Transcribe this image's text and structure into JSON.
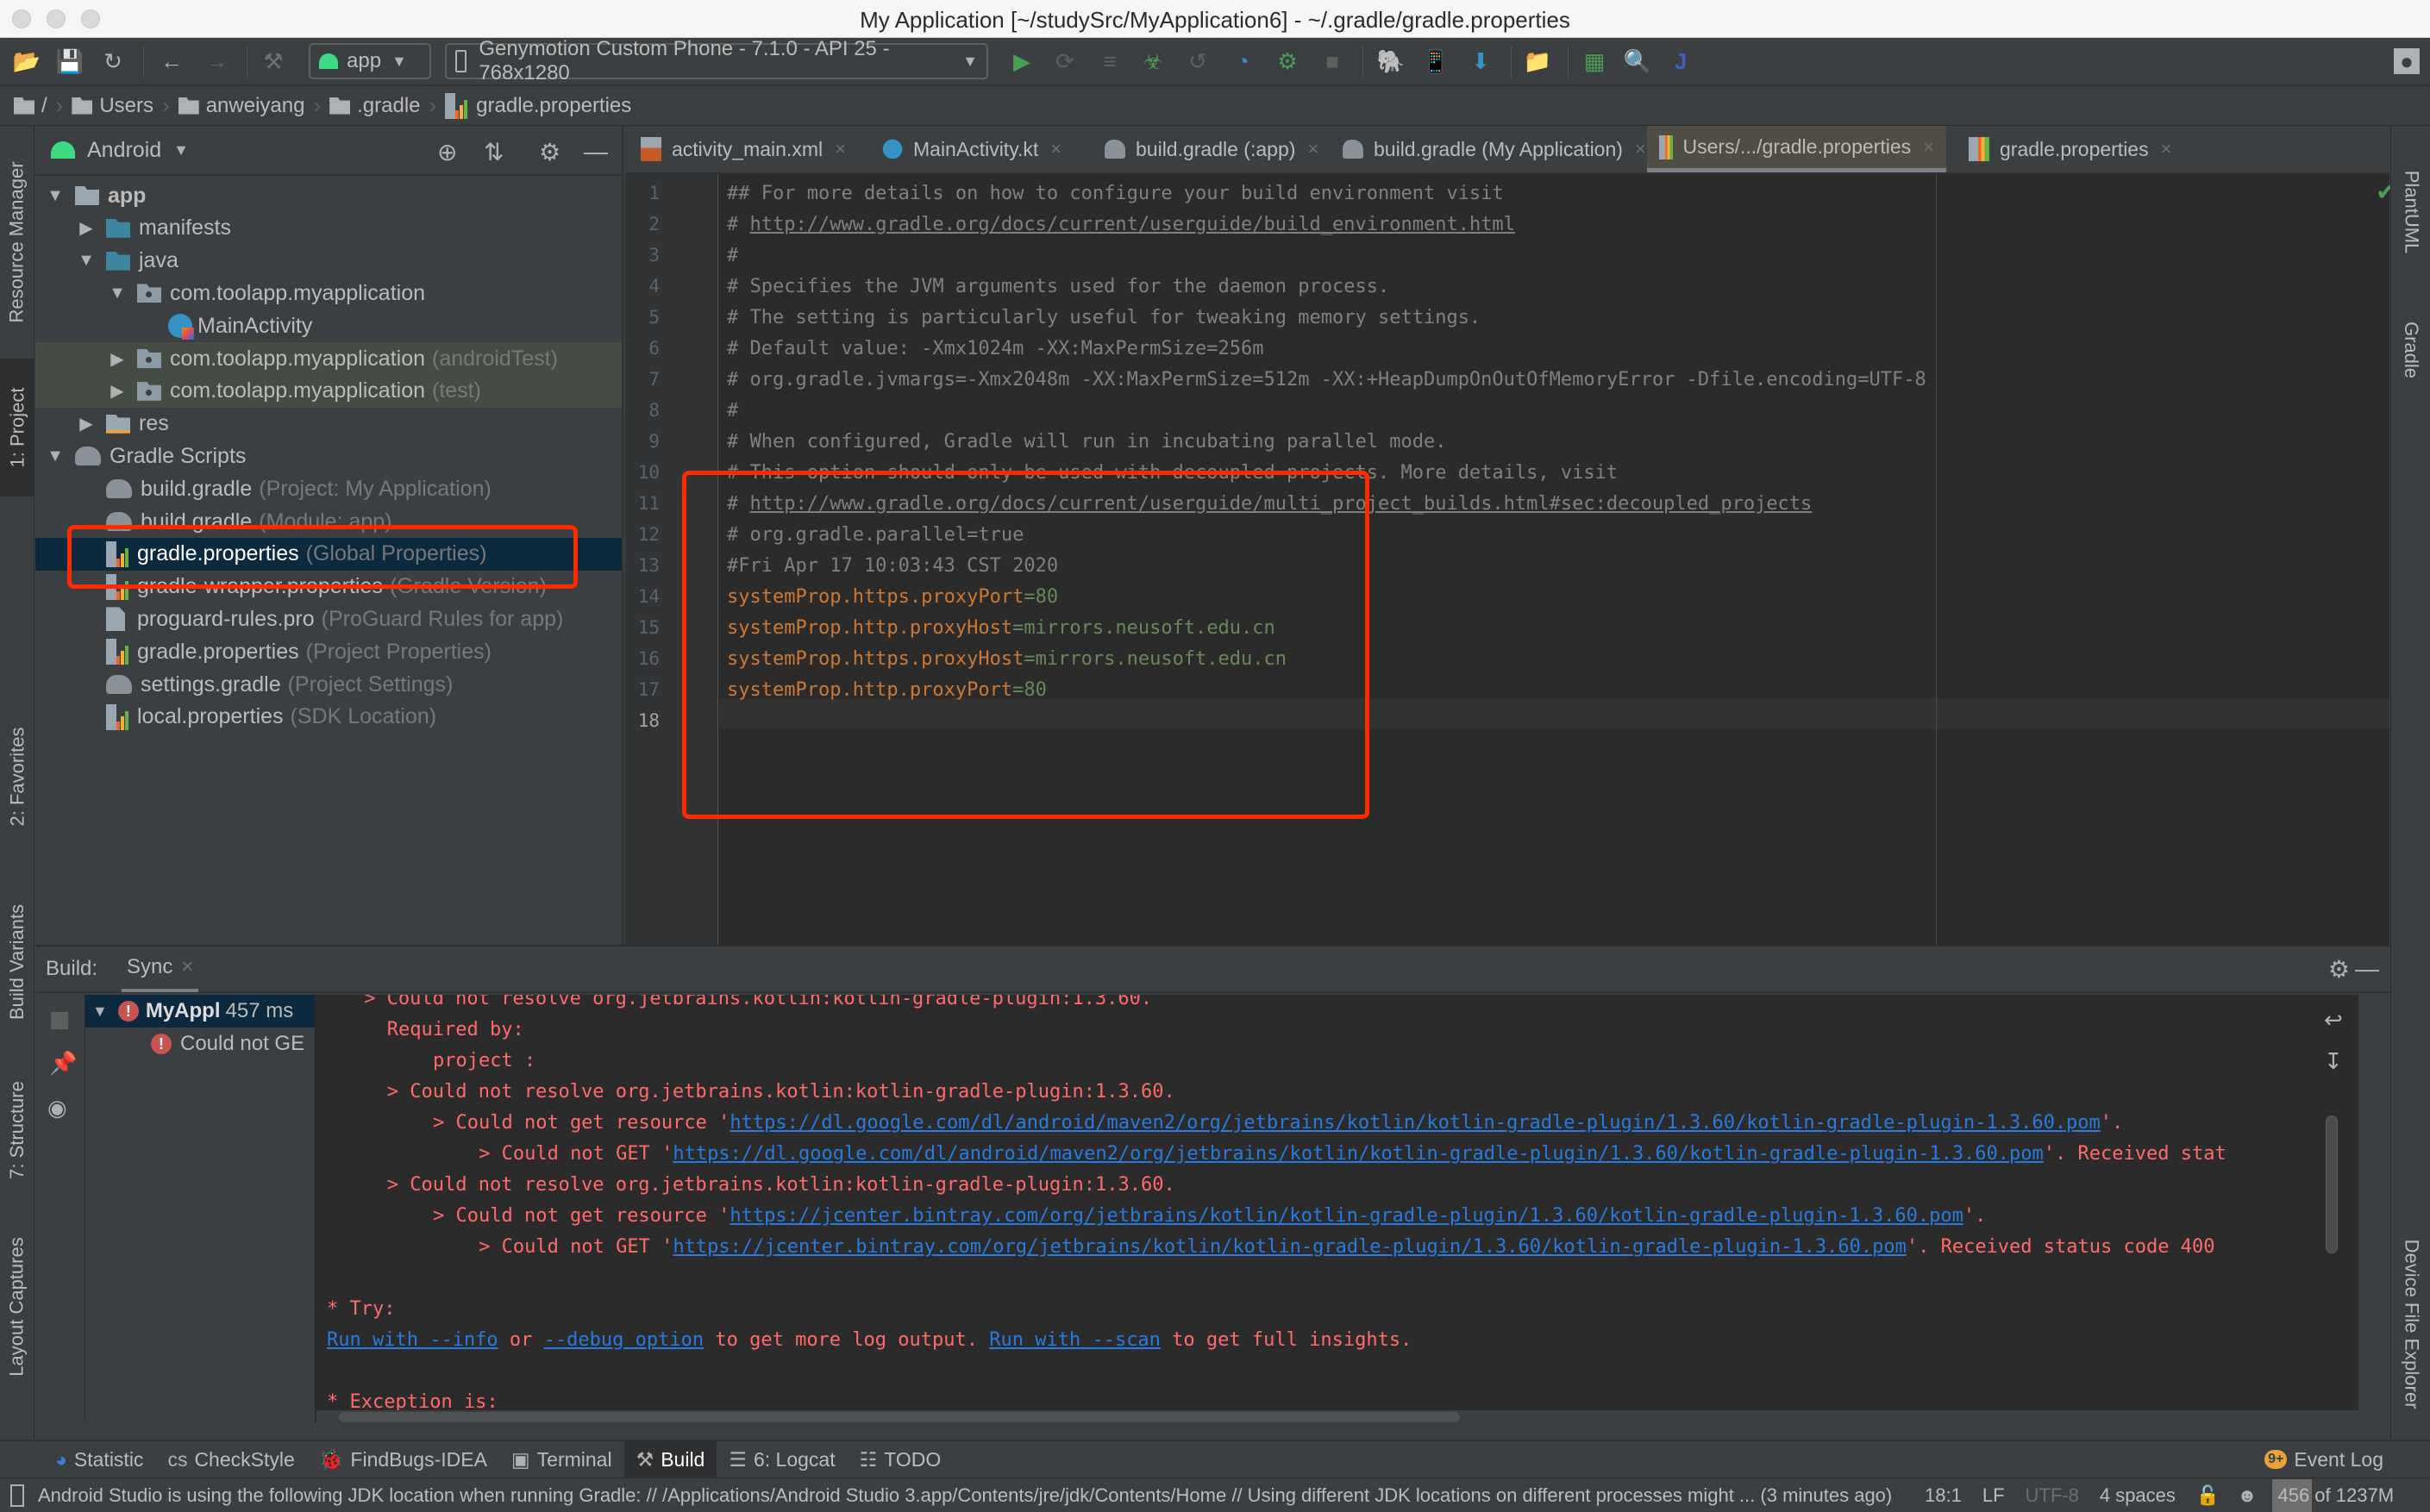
{
  "window": {
    "title": "My Application [~/studySrc/MyApplication6] - ~/.gradle/gradle.properties"
  },
  "toolbar": {
    "icons": [
      "open-folder-icon",
      "save-icon",
      "sync-icon",
      "back-icon",
      "forward-icon",
      "hammer-icon",
      "run-icon",
      "apply-changes-icon",
      "apply-code-changes-icon",
      "debug-icon",
      "attach-debugger-icon",
      "profile-icon",
      "coverage-icon",
      "stop-icon",
      "gradle-sync-icon",
      "avd-manager-icon",
      "sdk-manager-icon",
      "project-structure-icon",
      "terminal-icon",
      "search-icon",
      "jetbrains-icon",
      "user-icon"
    ],
    "config_combo": "app",
    "device_combo": "Genymotion Custom Phone - 7.1.0 - API 25 - 768x1280"
  },
  "breadcrumb": [
    "/",
    "Users",
    "anweiyang",
    ".gradle",
    "gradle.properties"
  ],
  "left_strip": {
    "tabs": [
      "Resource Manager",
      "1: Project",
      "2: Favorites",
      "Build Variants",
      "7: Structure",
      "Layout Captures"
    ]
  },
  "right_strip": {
    "tabs": [
      "PlantUML",
      "Gradle",
      "Device File Explorer"
    ]
  },
  "project_panel": {
    "view_mode": "Android",
    "tree": [
      {
        "label": "app",
        "hint": "",
        "expanded": true
      },
      {
        "label": "manifests",
        "hint": "",
        "expanded": false
      },
      {
        "label": "java",
        "hint": "",
        "expanded": true
      },
      {
        "label": "com.toolapp.myapplication",
        "hint": "",
        "expanded": true
      },
      {
        "label": "MainActivity",
        "hint": ""
      },
      {
        "label": "com.toolapp.myapplication",
        "hint": "(androidTest)",
        "expanded": false
      },
      {
        "label": "com.toolapp.myapplication",
        "hint": "(test)",
        "expanded": false
      },
      {
        "label": "res",
        "hint": "",
        "expanded": false
      },
      {
        "label": "Gradle Scripts",
        "hint": "",
        "expanded": true
      },
      {
        "label": "build.gradle",
        "hint": "(Project: My Application)"
      },
      {
        "label": "build.gradle",
        "hint": "(Module: app)"
      },
      {
        "label": "gradle.properties",
        "hint": "(Global Properties)",
        "selected": true
      },
      {
        "label": "gradle-wrapper.properties",
        "hint": "(Gradle Version)"
      },
      {
        "label": "proguard-rules.pro",
        "hint": "(ProGuard Rules for app)"
      },
      {
        "label": "gradle.properties",
        "hint": "(Project Properties)"
      },
      {
        "label": "settings.gradle",
        "hint": "(Project Settings)"
      },
      {
        "label": "local.properties",
        "hint": "(SDK Location)"
      }
    ]
  },
  "editor": {
    "tabs": [
      {
        "label": "activity_main.xml",
        "active": false
      },
      {
        "label": "MainActivity.kt",
        "active": false
      },
      {
        "label": "build.gradle (:app)",
        "active": false
      },
      {
        "label": "build.gradle (My Application)",
        "active": false
      },
      {
        "label": "Users/.../gradle.properties",
        "active": true
      },
      {
        "label": "gradle.properties",
        "active": false
      }
    ],
    "lines": [
      {
        "n": "1",
        "text": "## For more details on how to configure your build environment visit"
      },
      {
        "n": "2",
        "prefix": "# ",
        "url": "http://www.gradle.org/docs/current/userguide/build_environment.html"
      },
      {
        "n": "3",
        "text": "#"
      },
      {
        "n": "4",
        "text": "# Specifies the JVM arguments used for the daemon process."
      },
      {
        "n": "5",
        "text": "# The setting is particularly useful for tweaking memory settings."
      },
      {
        "n": "6",
        "text": "# Default value: -Xmx1024m -XX:MaxPermSize=256m"
      },
      {
        "n": "7",
        "text": "# org.gradle.jvmargs=-Xmx2048m -XX:MaxPermSize=512m -XX:+HeapDumpOnOutOfMemoryError -Dfile.encoding=UTF-8"
      },
      {
        "n": "8",
        "text": "#"
      },
      {
        "n": "9",
        "text": "# When configured, Gradle will run in incubating parallel mode."
      },
      {
        "n": "10",
        "text": "# This option should only be used with decoupled projects. More details, visit"
      },
      {
        "n": "11",
        "prefix": "# ",
        "url": "http://www.gradle.org/docs/current/userguide/multi_project_builds.html#sec:decoupled_projects"
      },
      {
        "n": "12",
        "text": "# org.gradle.parallel=true"
      },
      {
        "n": "13",
        "text": "#Fri Apr 17 10:03:43 CST 2020"
      },
      {
        "n": "14",
        "key": "systemProp.https.proxyPort",
        "value": "80"
      },
      {
        "n": "15",
        "key": "systemProp.http.proxyHost",
        "value": "mirrors.neusoft.edu.cn"
      },
      {
        "n": "16",
        "key": "systemProp.https.proxyHost",
        "value": "mirrors.neusoft.edu.cn"
      },
      {
        "n": "17",
        "key": "systemProp.http.proxyPort",
        "value": "80"
      },
      {
        "n": "18",
        "text": ""
      }
    ]
  },
  "build_panel": {
    "label": "Build:",
    "tab": "Sync",
    "tree": [
      {
        "label": "MyAppl",
        "time": "457 ms"
      },
      {
        "label": "Could not GE"
      }
    ],
    "console": [
      {
        "text": "> Could not resolve org.jetbrains.kotlin:kotlin-gradle-plugin:1.3.60.",
        "indent": 2
      },
      {
        "text": "Required by:",
        "indent": 3
      },
      {
        "text": "project :",
        "indent": 5
      },
      {
        "text": "> Could not resolve org.jetbrains.kotlin:kotlin-gradle-plugin:1.3.60.",
        "indent": 3
      },
      {
        "text": "> Could not get resource '",
        "url": "https://dl.google.com/dl/android/maven2/org/jetbrains/kotlin/kotlin-gradle-plugin/1.3.60/kotlin-gradle-plugin-1.3.60.pom",
        "suffix": "'.",
        "indent": 5
      },
      {
        "text": "> Could not GET '",
        "url": "https://dl.google.com/dl/android/maven2/org/jetbrains/kotlin/kotlin-gradle-plugin/1.3.60/kotlin-gradle-plugin-1.3.60.pom",
        "suffix": "'. Received stat",
        "indent": 7
      },
      {
        "text": "> Could not resolve org.jetbrains.kotlin:kotlin-gradle-plugin:1.3.60.",
        "indent": 3
      },
      {
        "text": "> Could not get resource '",
        "url": "https://jcenter.bintray.com/org/jetbrains/kotlin/kotlin-gradle-plugin/1.3.60/kotlin-gradle-plugin-1.3.60.pom",
        "suffix": "'.",
        "indent": 5
      },
      {
        "text": "> Could not GET '",
        "url": "https://jcenter.bintray.com/org/jetbrains/kotlin/kotlin-gradle-plugin/1.3.60/kotlin-gradle-plugin-1.3.60.pom",
        "suffix": "'. Received status code 400",
        "indent": 7
      },
      {
        "text": "",
        "indent": 0
      },
      {
        "text": "* Try:",
        "indent": 0
      },
      {
        "try": true
      },
      {
        "text": "",
        "indent": 0
      },
      {
        "text": "* Exception is:",
        "indent": 0
      }
    ],
    "try_line": {
      "link1": "Run with --info",
      "t1": " or ",
      "link2": "--debug option",
      "t2": " to get more log output. ",
      "link3": "Run with --scan",
      "t3": " to get full insights."
    }
  },
  "tool_tabs": [
    {
      "label": "Statistic",
      "icon": "statistic-icon"
    },
    {
      "label": "CheckStyle",
      "icon": "checkstyle-icon"
    },
    {
      "label": "FindBugs-IDEA",
      "icon": "findbugs-icon"
    },
    {
      "label": "Terminal",
      "icon": "terminal-icon"
    },
    {
      "label": "Build",
      "icon": "hammer-icon",
      "active": true
    },
    {
      "label": "6: Logcat",
      "icon": "logcat-icon"
    },
    {
      "label": "TODO",
      "icon": "todo-icon"
    }
  ],
  "event_log": {
    "label": "Event Log",
    "badge": "9+"
  },
  "status": {
    "message": "Android Studio is using the following JDK location when running Gradle: // /Applications/Android Studio 3.app/Contents/jre/jdk/Contents/Home // Using different JDK locations on different processes might ... (3 minutes ago)",
    "position": "18:1",
    "line_sep": "LF",
    "encoding": "UTF-8",
    "indent": "4 spaces",
    "memory": "456 of 1237M",
    "memory_used_fraction": 0.369
  },
  "colors": {
    "accent_red_box": "#ff2a00",
    "error_text": "#ff6b68",
    "link": "#287bde",
    "prop_key": "#cc7832",
    "prop_value": "#6a8759"
  }
}
